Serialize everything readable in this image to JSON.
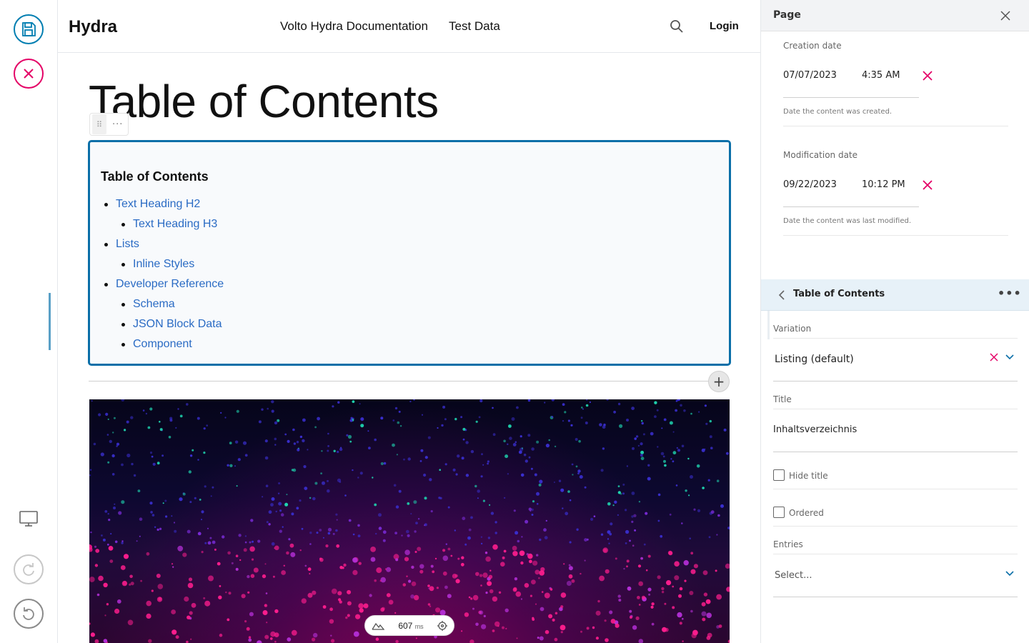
{
  "toolbar": {
    "save_icon": "save-icon",
    "cancel_icon": "close-circle-icon",
    "device_icon": "monitor-icon",
    "redo_icon": "redo-icon",
    "undo_icon": "undo-icon"
  },
  "header": {
    "logo": "Hydra",
    "nav": [
      "Volto Hydra Documentation",
      "Test Data"
    ],
    "login": "Login"
  },
  "main": {
    "title": "Table of Contents",
    "block_menu": "···",
    "toc": {
      "heading": "Table of Contents",
      "items": [
        {
          "label": "Text Heading H2",
          "level": 1
        },
        {
          "label": "Text Heading H3",
          "level": 2
        },
        {
          "label": "Lists",
          "level": 1
        },
        {
          "label": "Inline Styles",
          "level": 2
        },
        {
          "label": "Developer Reference",
          "level": 1
        },
        {
          "label": "Schema",
          "level": 2
        },
        {
          "label": "JSON Block Data",
          "level": 2
        },
        {
          "label": "Component",
          "level": 2
        }
      ]
    },
    "add_block": "+",
    "speed": {
      "value": "607",
      "unit": "ms"
    }
  },
  "sidebar": {
    "title": "Page",
    "creation": {
      "label": "Creation date",
      "date": "07/07/2023",
      "time": "4:35 AM",
      "help": "Date the content was created."
    },
    "modification": {
      "label": "Modification date",
      "date": "09/22/2023",
      "time": "10:12 PM",
      "help": "Date the content was last modified."
    },
    "block": {
      "title": "Table of Contents",
      "more": "•••",
      "variation_label": "Variation",
      "variation_value": "Listing (default)",
      "title_label": "Title",
      "title_value": "Inhaltsverzeichnis",
      "hide_title": "Hide title",
      "ordered": "Ordered",
      "entries_label": "Entries",
      "entries_placeholder": "Select..."
    }
  },
  "colors": {
    "primary": "#007eb1",
    "danger": "#e40166",
    "link": "#2a6bc4"
  }
}
